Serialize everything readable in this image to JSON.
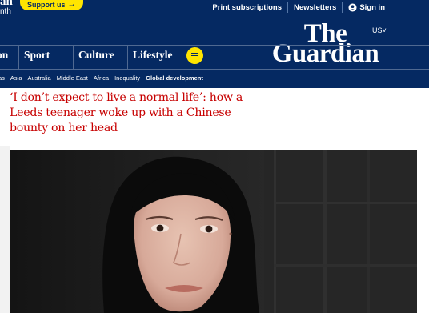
{
  "masthead": {
    "cropped_top_text": "an",
    "cropped_bottom_text": "nth",
    "support_label": "Support us",
    "links": [
      "Print subscriptions",
      "Newsletters",
      "Sign in"
    ],
    "edition": "US",
    "logo": [
      "The",
      "Guardian"
    ],
    "pillars": [
      "on",
      "Sport",
      "Culture",
      "Lifestyle"
    ],
    "subnav": [
      "as",
      "Asia",
      "Australia",
      "Middle East",
      "Africa",
      "Inequality",
      "Global development"
    ],
    "colors": {
      "brand": "#052962",
      "accent": "#ffe500"
    },
    "icons": {
      "support_arrow": "arrow-right-icon",
      "sign_in": "user-icon",
      "edition": "chevron-down-icon",
      "menu": "menu-icon"
    }
  },
  "article": {
    "headline": "‘I don’t expect to live a normal life’: how a Leeds teenager woke up with a Chinese bounty on her head",
    "headline_color": "#c70000"
  }
}
